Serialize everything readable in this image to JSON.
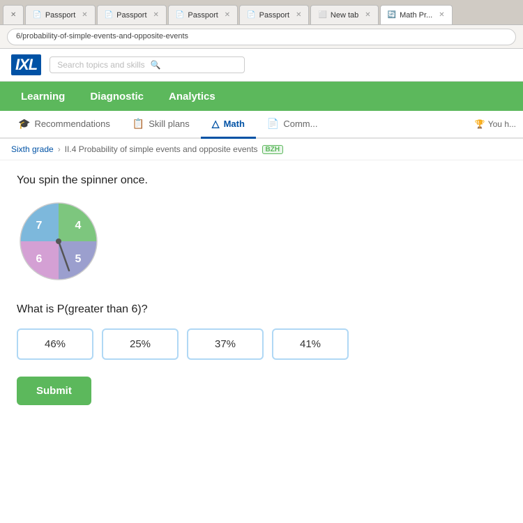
{
  "browser": {
    "tabs": [
      {
        "label": "Passport",
        "icon": "📄",
        "active": false
      },
      {
        "label": "Passport",
        "icon": "📄",
        "active": false
      },
      {
        "label": "Passport",
        "icon": "📄",
        "active": false
      },
      {
        "label": "Passport",
        "icon": "📄",
        "active": false
      },
      {
        "label": "New tab",
        "icon": "⬜",
        "active": false
      },
      {
        "label": "Math Pr...",
        "icon": "🔄",
        "active": true
      }
    ],
    "address": "6/probability-of-simple-events-and-opposite-events"
  },
  "ixl": {
    "logo": "IXL",
    "search_placeholder": "Search topics and skills",
    "nav": {
      "items": [
        "Learning",
        "Diagnostic",
        "Analytics"
      ]
    },
    "tabs": [
      {
        "label": "Recommendations",
        "icon": "🎓",
        "active": false
      },
      {
        "label": "Skill plans",
        "icon": "📋",
        "active": false
      },
      {
        "label": "Math",
        "icon": "△",
        "active": true
      },
      {
        "label": "Comm...",
        "icon": "📄",
        "active": false
      }
    ],
    "breadcrumb": {
      "grade": "Sixth grade",
      "lesson": "II.4 Probability of simple events and opposite events",
      "badge": "BZH"
    },
    "question": {
      "text": "You spin the spinner once.",
      "prompt": "What is P(greater than 6)?",
      "choices": [
        "46%",
        "25%",
        "37%",
        "41%"
      ],
      "submit_label": "Submit"
    },
    "spinner": {
      "sections": [
        {
          "label": "7",
          "color": "#7dc67e",
          "startAngle": 0,
          "endAngle": 90
        },
        {
          "label": "4",
          "color": "#9b9fce",
          "startAngle": 90,
          "endAngle": 180
        },
        {
          "label": "5",
          "color": "#d4a0d4",
          "startAngle": 180,
          "endAngle": 270
        },
        {
          "label": "6",
          "color": "#7db8dc",
          "startAngle": 270,
          "endAngle": 360
        }
      ]
    },
    "you_have": "You h..."
  }
}
